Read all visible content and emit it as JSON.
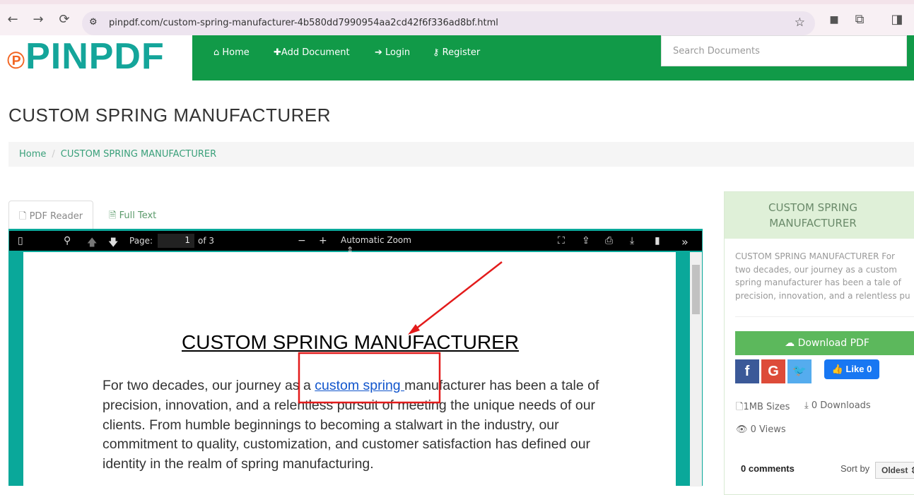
{
  "browser": {
    "url": "pinpdf.com/custom-spring-manufacturer-4b580dd7990954aa2cd42f6f336ad8bf.html"
  },
  "header": {
    "logo": "PINPDF",
    "menu": [
      {
        "label": "Home",
        "icon": "home-icon"
      },
      {
        "label": "Add Document",
        "icon": "plus-icon"
      },
      {
        "label": "Login",
        "icon": "login-icon"
      },
      {
        "label": "Register",
        "icon": "key-icon"
      }
    ],
    "search_placeholder": "Search Documents"
  },
  "page": {
    "title": "CUSTOM SPRING MANUFACTURER",
    "breadcrumb": [
      "Home",
      "CUSTOM SPRING MANUFACTURER"
    ]
  },
  "tabs": [
    {
      "label": "PDF Reader"
    },
    {
      "label": "Full Text"
    }
  ],
  "viewer": {
    "page_label": "Page:",
    "page": "1",
    "of": "of 3",
    "zoom": "Automatic Zoom"
  },
  "document": {
    "title": "CUSTOM SPRING MANUFACTURER",
    "para_before": "For two decades, our journey as a ",
    "link": "custom spring ",
    "para_after": "manufacturer has been a tale of precision, innovation, and a relentless pursuit of meeting the unique needs of our clients. From humble beginnings to becoming a stalwart in the industry, our commitment to quality, customization, and customer satisfaction has defined our identity in the realm of spring manufacturing."
  },
  "sidebar": {
    "title": "CUSTOM SPRING MANUFACTURER",
    "desc": [
      "CUSTOM SPRING MANUFACTURER For",
      "two decades, our journey as a custom",
      "spring manufacturer has been a tale of",
      "precision, innovation, and a relentless pu"
    ],
    "download": "Download PDF",
    "like": "Like 0",
    "size": "1MB Sizes",
    "downloads": "0 Downloads",
    "views": "0 Views",
    "comments": "0 comments",
    "sort_by": "Sort by",
    "sort_value": "Oldest"
  },
  "colors": {
    "green": "#119a48",
    "teal": "#0aa89a",
    "annotation": "#e31b1b"
  }
}
